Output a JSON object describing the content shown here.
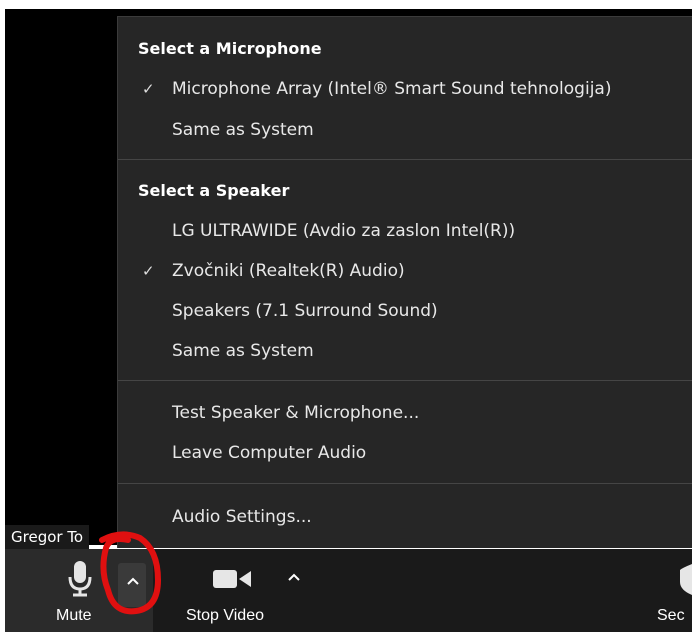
{
  "meeting": {
    "participant_name": "Gregor To"
  },
  "audio_menu": {
    "microphone": {
      "header": "Select a Microphone",
      "items": [
        {
          "label": "Microphone Array (Intel® Smart Sound tehnologija)",
          "checked": true
        },
        {
          "label": "Same as System",
          "checked": false
        }
      ]
    },
    "speaker": {
      "header": "Select a Speaker",
      "items": [
        {
          "label": "LG ULTRAWIDE (Avdio za zaslon Intel(R))",
          "checked": false
        },
        {
          "label": "Zvočniki (Realtek(R) Audio)",
          "checked": true
        },
        {
          "label": "Speakers (7.1 Surround Sound)",
          "checked": false
        },
        {
          "label": "Same as System",
          "checked": false
        }
      ]
    },
    "test_label": "Test Speaker & Microphone...",
    "leave_label": "Leave Computer Audio",
    "settings_label": "Audio Settings...",
    "check_glyph": "✓"
  },
  "toolbar": {
    "mute_label": "Mute",
    "stop_video_label": "Stop Video",
    "security_label_partial": "Sec",
    "caret_glyph": "^"
  },
  "colors": {
    "menu_bg": "#262626",
    "toolbar_bg": "#1a1a1a",
    "annotation_red": "#e01010"
  }
}
